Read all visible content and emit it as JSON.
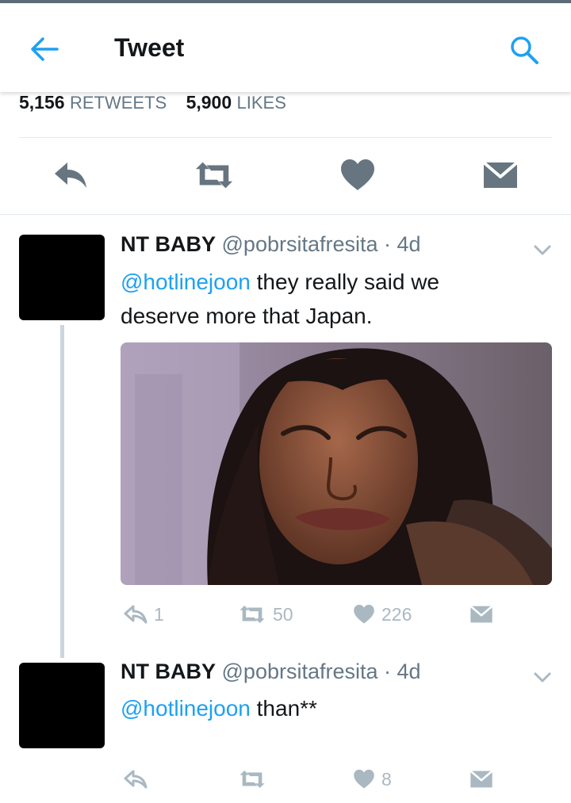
{
  "header": {
    "title": "Tweet",
    "back_icon": "arrow-left-icon",
    "search_icon": "search-icon",
    "accent": "#1da1f2"
  },
  "stats": {
    "retweets_count": "5,156",
    "retweets_label": "RETWEETS",
    "likes_count": "5,900",
    "likes_label": "LIKES"
  },
  "actions": [
    "reply-icon",
    "retweet-icon",
    "heart-icon",
    "message-icon"
  ],
  "replies": [
    {
      "name": "NT BABY",
      "handle": "@pobrsitafresita",
      "time": "· 4d",
      "mention": "@hotlinejoon",
      "text_line1": " they really said we",
      "text_line2": "deserve more that Japan.",
      "reply_count": "1",
      "retweet_count": "50",
      "like_count": "226"
    },
    {
      "name": "NT BABY",
      "handle": "@pobrsitafresita",
      "time": "· 4d",
      "mention": "@hotlinejoon",
      "text": " than**",
      "reply_count": "",
      "retweet_count": "",
      "like_count": "8"
    }
  ]
}
